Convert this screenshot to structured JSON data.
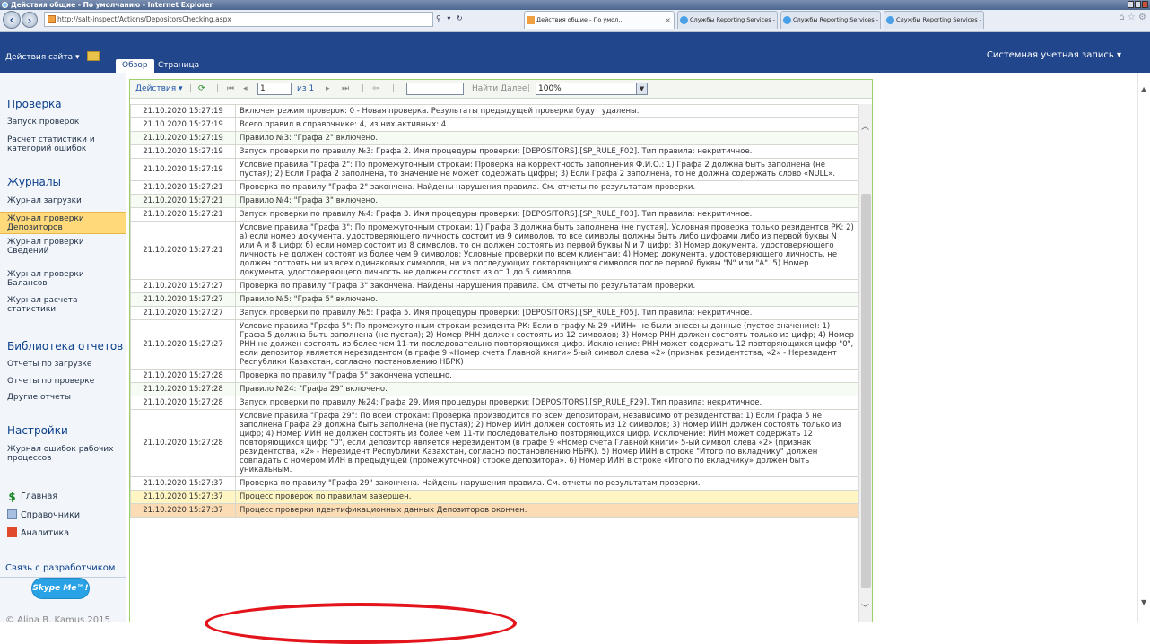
{
  "window": {
    "title": "Действия общие - По умолчанию - Internet Explorer"
  },
  "address_bar": {
    "url": "http://salt-inspect/Actions/DepositorsChecking.aspx"
  },
  "browser_tabs": [
    {
      "label": "Действия общие - По умол...",
      "active": true
    },
    {
      "label": "Службы Reporting Services - О...",
      "active": false
    },
    {
      "label": "Службы Reporting Services - О...",
      "active": false
    },
    {
      "label": "Службы Reporting Services - О...",
      "active": false
    }
  ],
  "ribbon": {
    "site_actions": "Действия сайта",
    "tabs": [
      "Обзор",
      "Страница"
    ],
    "account": "Системная учетная запись"
  },
  "sidebar": {
    "sections": [
      {
        "title": "Проверка",
        "items": [
          "Запуск проверок",
          "Расчет статистики и категорий ошибок"
        ]
      },
      {
        "title": "Журналы",
        "items": [
          "Журнал загрузки",
          "Журнал проверки Депозиторов",
          "Журнал проверки Сведений",
          "Журнал проверки Балансов",
          "Журнал расчета статистики"
        ]
      },
      {
        "title": "Библиотека отчетов",
        "items": [
          "Отчеты по загрузке",
          "Отчеты по проверке",
          "Другие отчеты"
        ]
      },
      {
        "title": "Настройки",
        "items": [
          "Журнал ошибок рабочих процессов"
        ]
      }
    ],
    "selected_item": "Журнал проверки Депозиторов",
    "quick_links": [
      "Главная",
      "Справочники",
      "Аналитика"
    ],
    "dev_link": "Связь с разработчиком",
    "skype": "Skype Me™!",
    "copyright": "© Alina B. Kamus 2015"
  },
  "report_toolbar": {
    "actions": "Действия",
    "page_current": "1",
    "page_of": "из 1",
    "find_next": "Найти Далее",
    "zoom": "100%"
  },
  "log": [
    {
      "ts": "21.10.2020 15:27:19",
      "msg": "Включен режим проверок: 0 - Новая проверка. Результаты предыдущей проверки будут удалены.",
      "style": "white"
    },
    {
      "ts": "21.10.2020 15:27:19",
      "msg": "Всего правил в справочнике: 4, из них активных: 4.",
      "style": "white"
    },
    {
      "ts": "21.10.2020 15:27:19",
      "msg": "Правило №3: \"Графа 2\" включено.",
      "style": "alt"
    },
    {
      "ts": "21.10.2020 15:27:19",
      "msg": "Запуск проверки по правилу №3: Графа 2. Имя процедуры проверки: [DEPOSITORS].[SP_RULE_F02]. Тип правила: некритичное.",
      "style": "white"
    },
    {
      "ts": "21.10.2020 15:27:19",
      "msg": "Условие правила \"Графа 2\": По промежуточным строкам: Проверка на корректность заполнения Ф.И.О.: 1) Графа 2 должна быть заполнена (не пустая); 2) Если Графа 2 заполнена, то значение не может содержать цифры; 3) Если Графа 2 заполнена, то не должна содержать слово «NULL».",
      "style": "white"
    },
    {
      "ts": "21.10.2020 15:27:21",
      "msg": "Проверка по правилу \"Графа 2\" закончена. Найдены нарушения правила. См. отчеты по результатам проверки.",
      "style": "red"
    },
    {
      "ts": "21.10.2020 15:27:21",
      "msg": "Правило №4: \"Графа 3\" включено.",
      "style": "alt"
    },
    {
      "ts": "21.10.2020 15:27:21",
      "msg": "Запуск проверки по правилу №4: Графа 3. Имя процедуры проверки: [DEPOSITORS].[SP_RULE_F03]. Тип правила: некритичное.",
      "style": "white"
    },
    {
      "ts": "21.10.2020 15:27:21",
      "msg": "Условие правила \"Графа 3\": По промежуточным строкам: 1) Графа 3 должна быть заполнена (не пустая). Условная проверка только резидентов РК: 2) а) если номер документа, удостоверяющего личность состоит из 9 символов, то все символы должны быть либо цифрами либо из первой буквы N или А и 8 цифр; б) если номер состоит из 8 символов, то он должен состоять из первой буквы N и 7 цифр; 3) Номер документа, удостоверяющего личность не должен состоят из более чем 9 символов; Условные проверки по всем клиентам: 4) Номер документа, удостоверяющего личность, не должен состоять ни из всех одинаковых символов, ни из последующих повторяющихся символов после первой буквы \"N\" или \"А\". 5) Номер документа, удостоверяющего личность не должен состоят из от 1 до 5 символов.",
      "style": "white"
    },
    {
      "ts": "21.10.2020 15:27:27",
      "msg": "Проверка по правилу \"Графа 3\" закончена. Найдены нарушения правила. См. отчеты по результатам проверки.",
      "style": "red"
    },
    {
      "ts": "21.10.2020 15:27:27",
      "msg": "Правило №5: \"Графа 5\" включено.",
      "style": "alt"
    },
    {
      "ts": "21.10.2020 15:27:27",
      "msg": "Запуск проверки по правилу №5: Графа 5. Имя процедуры проверки: [DEPOSITORS].[SP_RULE_F05]. Тип правила: некритичное.",
      "style": "white"
    },
    {
      "ts": "21.10.2020 15:27:27",
      "msg": "Условие правила \"Графа 5\": По промежуточным строкам резидента РК: Если в графу № 29 «ИИН» не были внесены данные (пустое значение): 1) Графа 5 должна быть заполнена (не пустая); 2) Номер РНН должен состоять из 12 символов; 3) Номер РНН должен состоять только из цифр; 4) Номер РНН не должен состоять из более чем 11-ти последовательно повторяющихся цифр. Исключение: РНН может содержать 12 повторяющихся цифр \"0\", если депозитор является нерезидентом (в графе 9 «Номер счета Главной книги» 5-ый символ слева «2» (признак резидентства, «2» - Нерезидент Республики Казахстан, согласно постановлению НБРК)",
      "style": "white"
    },
    {
      "ts": "21.10.2020 15:27:28",
      "msg": "Проверка по правилу \"Графа 5\" закончена успешно.",
      "style": "green"
    },
    {
      "ts": "21.10.2020 15:27:28",
      "msg": "Правило №24: \"Графа 29\" включено.",
      "style": "alt"
    },
    {
      "ts": "21.10.2020 15:27:28",
      "msg": "Запуск проверки по правилу №24: Графа 29. Имя процедуры проверки: [DEPOSITORS].[SP_RULE_F29]. Тип правила: некритичное.",
      "style": "white"
    },
    {
      "ts": "21.10.2020 15:27:28",
      "msg": "Условие правила \"Графа 29\": По всем строкам: Проверка производится по всем депозиторам, независимо от резидентства: 1) Если Графа 5 не заполнена Графа 29 должна быть заполнена (не пустая); 2) Номер ИИН должен состоять из 12 символов; 3) Номер ИИН должен состоять только из цифр; 4) Номер ИИН не должен состоять из более чем 11-ти последовательно повторяющихся цифр. Исключение: ИИН может содержать 12 повторяющихся цифр \"0\", если депозитор является нерезидентом (в графе 9 «Номер счета Главной книги» 5-ый символ слева «2» (признак резидентства, «2» - Нерезидент Республики Казахстан, согласно постановлению НБРК). 5) Номер ИИН в строке \"Итого по вкладчику\" должен совпадать с номером ИИН в предыдущей (промежуточной) строке депозитора». 6) Номер ИИН в строке «Итого по вкладчику» должен быть уникальным.",
      "style": "white"
    },
    {
      "ts": "21.10.2020 15:27:37",
      "msg": "Проверка по правилу \"Графа 29\" закончена. Найдены нарушения правила. См. отчеты по результатам проверки.",
      "style": "red"
    },
    {
      "ts": "21.10.2020 15:27:37",
      "msg": "Процесс проверок по правилам завершен.",
      "style": "yellow"
    },
    {
      "ts": "21.10.2020 15:27:37",
      "msg": "Процесс проверки идентификационных данных Депозиторов окончен.",
      "style": "peach"
    }
  ]
}
